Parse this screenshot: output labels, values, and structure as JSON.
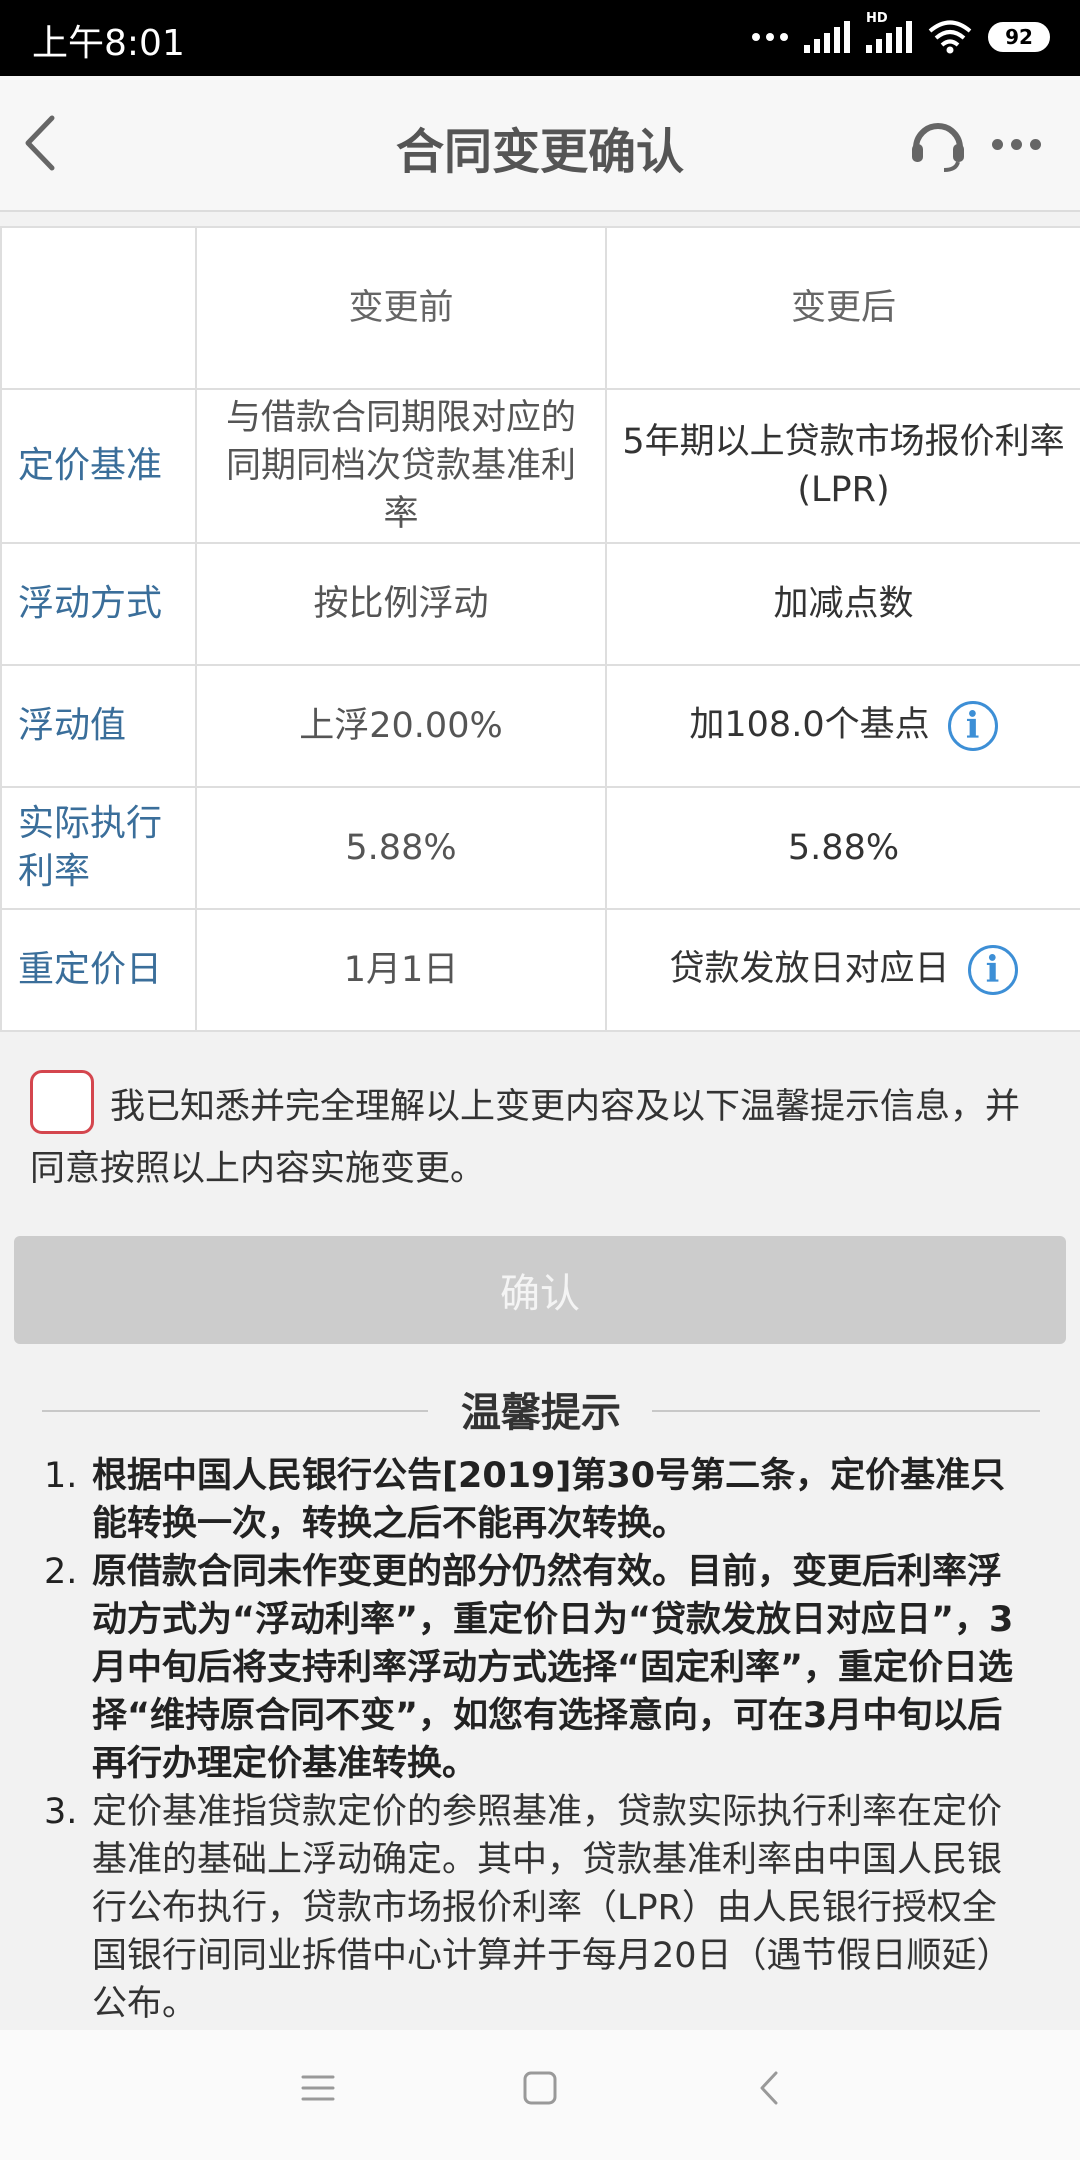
{
  "status_bar": {
    "time": "上午8:01",
    "network": "HD",
    "battery": "92"
  },
  "header": {
    "title": "合同变更确认"
  },
  "table": {
    "columns": [
      "变更前",
      "变更后"
    ],
    "rows": [
      {
        "label": "定价基准",
        "before": "与借款合同期限对应的同期同档次贷款基准利率",
        "after": "5年期以上贷款市场报价利率(LPR)"
      },
      {
        "label": "浮动方式",
        "before": "按比例浮动",
        "after": "加减点数"
      },
      {
        "label": "浮动值",
        "before": "上浮20.00%",
        "after": "加108.0个基点"
      },
      {
        "label": "实际执行利率",
        "before": "5.88%",
        "after": "5.88%"
      },
      {
        "label": "重定价日",
        "before": "1月1日",
        "after": "贷款发放日对应日"
      }
    ]
  },
  "agreement": {
    "text": "我已知悉并完全理解以上变更内容及以下温馨提示信息，并同意按照以上内容实施变更。",
    "checked": false
  },
  "confirm_button": {
    "label": "确认"
  },
  "tips": {
    "title": "温馨提示",
    "items": [
      {
        "num": "1.",
        "text": "根据中国人民银行公告[2019]第30号第二条，定价基准只能转换一次，转换之后不能再次转换。"
      },
      {
        "num": "2.",
        "text": "原借款合同未作变更的部分仍然有效。目前，变更后利率浮动方式为“浮动利率”，重定价日为“贷款发放日对应日”，3月中旬后将支持利率浮动方式选择“固定利率”，重定价日选择“维持原合同不变”，如您有选择意向，可在3月中旬以后再行办理定价基准转换。"
      },
      {
        "num": "3.",
        "text": "定价基准指贷款定价的参照基准，贷款实际执行利率在定价基准的基础上浮动确定。其中，贷款基准利率由中国人民银行公布执行，贷款市场报价利率（LPR）由人民银行授权全国银行间同业拆借中心计算并于每月20日（遇节假日顺延）公布。"
      }
    ]
  },
  "icons": {
    "back": "chevron-left-icon",
    "headset": "headset-icon",
    "more": "more-dots-icon",
    "info": "info-icon",
    "menu": "menu-icon",
    "home": "home-icon",
    "sys_back": "back-icon"
  },
  "colors": {
    "label": "#3a6e9a",
    "info": "#3d8fd6",
    "checkbox_border": "#d4464e",
    "button_disabled": "#cccccc"
  }
}
